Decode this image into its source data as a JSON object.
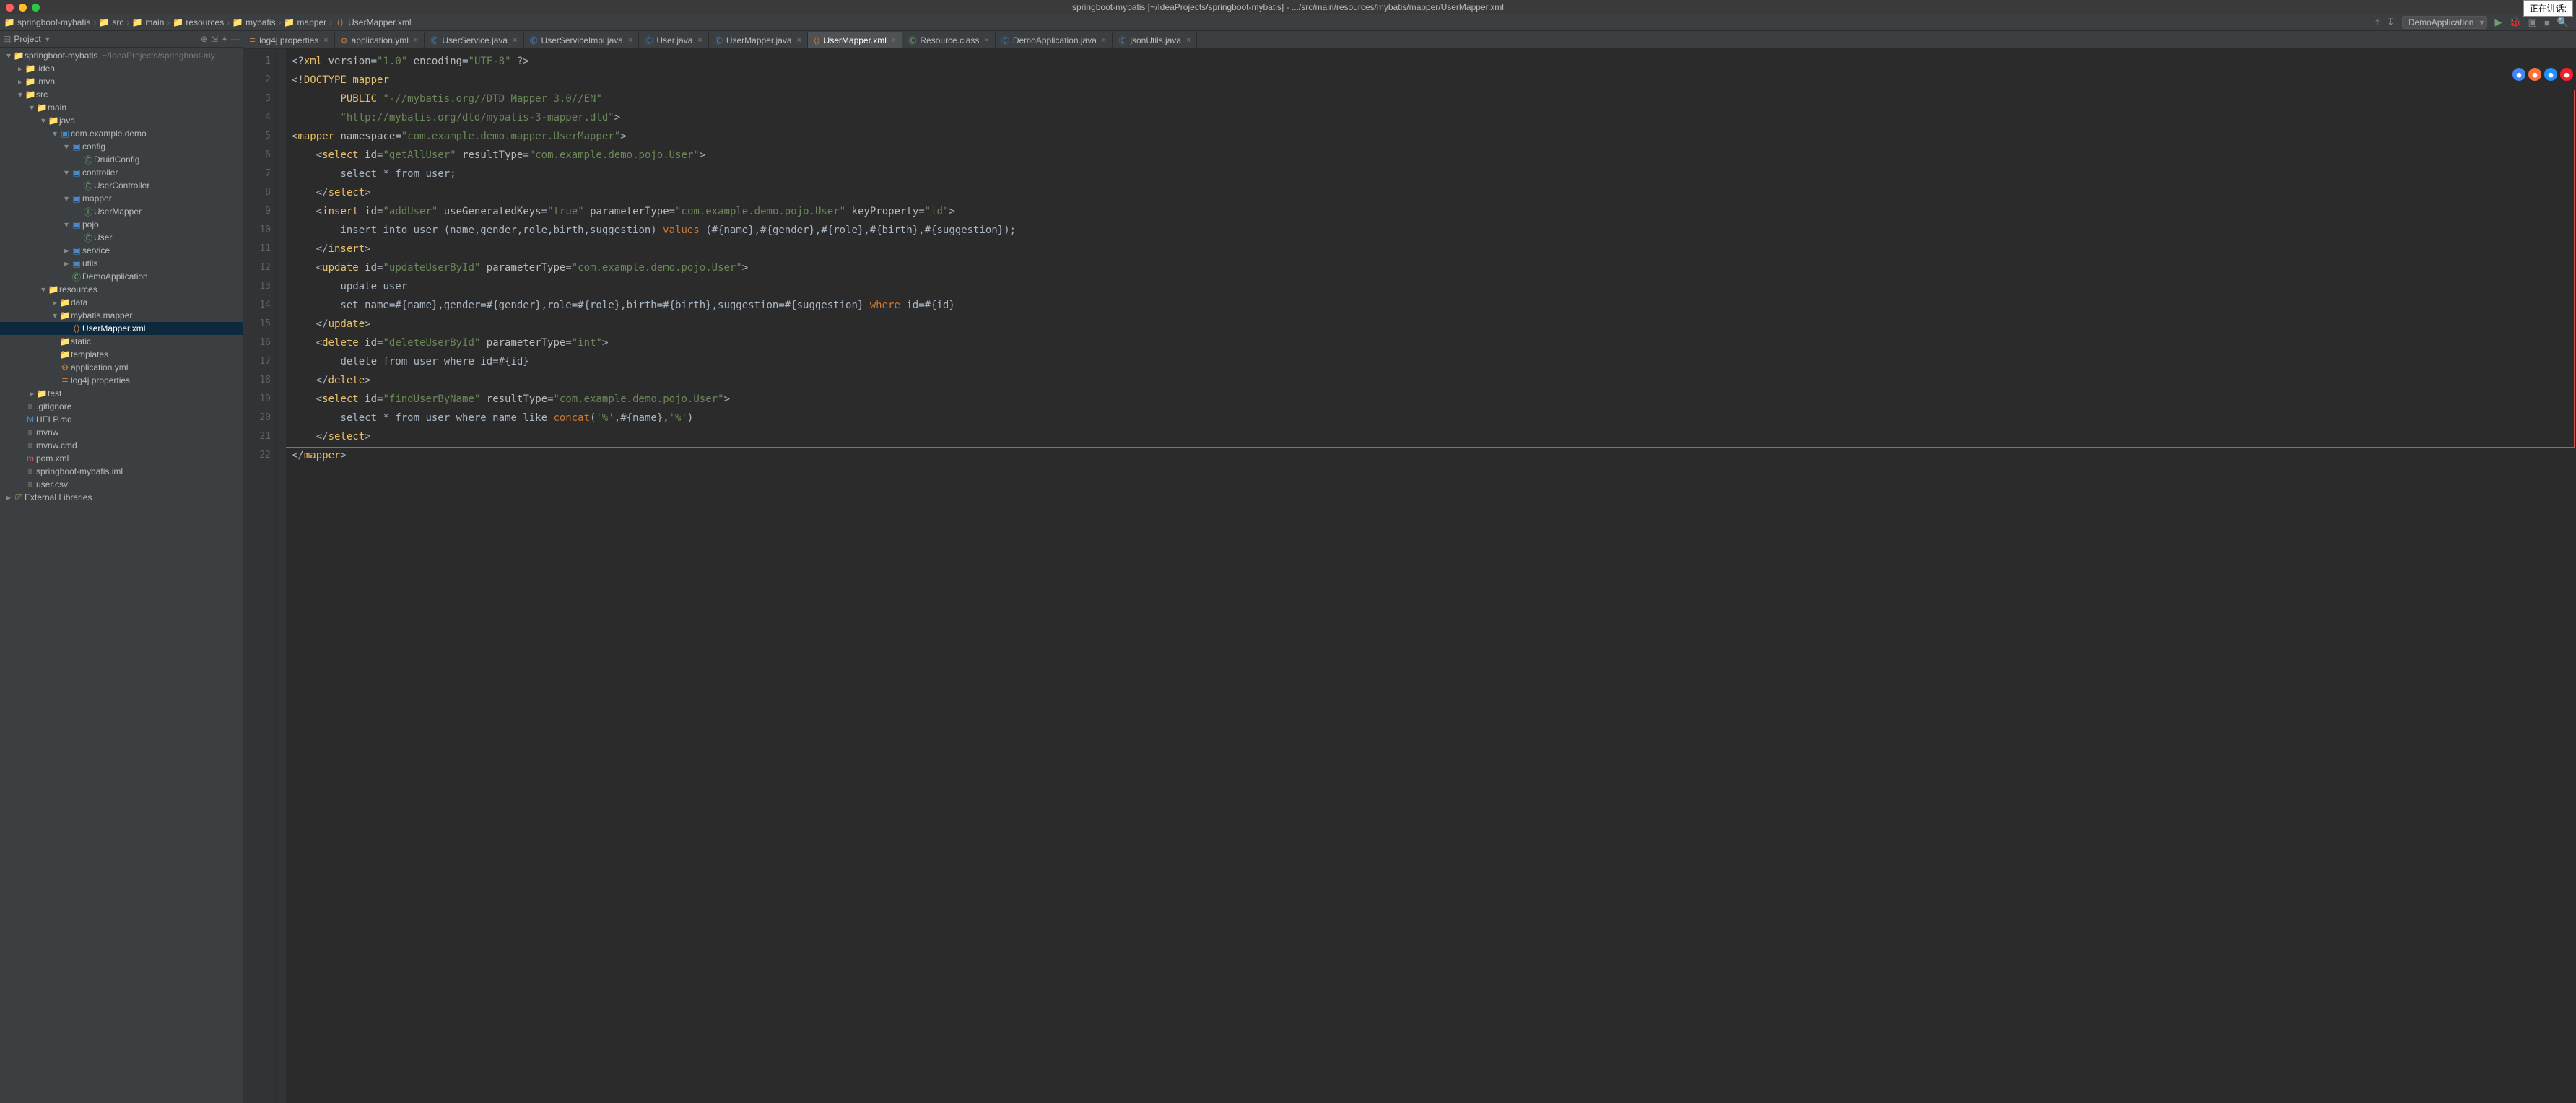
{
  "mac_title": "springboot-mybatis [~/IdeaProjects/springboot-mybatis] - .../src/main/resources/mybatis/mapper/UserMapper.xml",
  "speaking_label": "正在讲话:",
  "breadcrumbs": [
    {
      "icon": "folder",
      "label": "springboot-mybatis"
    },
    {
      "icon": "folder",
      "label": "src"
    },
    {
      "icon": "folder",
      "label": "main"
    },
    {
      "icon": "folder",
      "label": "resources"
    },
    {
      "icon": "folder",
      "label": "mybatis"
    },
    {
      "icon": "folder",
      "label": "mapper"
    },
    {
      "icon": "xml",
      "label": "UserMapper.xml"
    }
  ],
  "run_config": "DemoApplication",
  "project_pane_title": "Project",
  "tree": [
    {
      "d": 0,
      "tw": "▾",
      "ic": "folder",
      "lbl": "springboot-mybatis",
      "hint": "~/IdeaProjects/springboot-my…"
    },
    {
      "d": 1,
      "tw": "▸",
      "ic": "folder",
      "lbl": ".idea"
    },
    {
      "d": 1,
      "tw": "▸",
      "ic": "folder",
      "lbl": ".mvn"
    },
    {
      "d": 1,
      "tw": "▾",
      "ic": "folder",
      "lbl": "src"
    },
    {
      "d": 2,
      "tw": "▾",
      "ic": "folder",
      "lbl": "main"
    },
    {
      "d": 3,
      "tw": "▾",
      "ic": "folder-src",
      "lbl": "java"
    },
    {
      "d": 4,
      "tw": "▾",
      "ic": "package",
      "lbl": "com.example.demo"
    },
    {
      "d": 5,
      "tw": "▾",
      "ic": "package",
      "lbl": "config"
    },
    {
      "d": 6,
      "tw": "",
      "ic": "class",
      "lbl": "DruidConfig"
    },
    {
      "d": 5,
      "tw": "▾",
      "ic": "package",
      "lbl": "controller"
    },
    {
      "d": 6,
      "tw": "",
      "ic": "class",
      "lbl": "UserController"
    },
    {
      "d": 5,
      "tw": "▾",
      "ic": "package",
      "lbl": "mapper"
    },
    {
      "d": 6,
      "tw": "",
      "ic": "interface",
      "lbl": "UserMapper"
    },
    {
      "d": 5,
      "tw": "▾",
      "ic": "package",
      "lbl": "pojo"
    },
    {
      "d": 6,
      "tw": "",
      "ic": "class",
      "lbl": "User"
    },
    {
      "d": 5,
      "tw": "▸",
      "ic": "package",
      "lbl": "service"
    },
    {
      "d": 5,
      "tw": "▸",
      "ic": "package",
      "lbl": "utils"
    },
    {
      "d": 5,
      "tw": "",
      "ic": "class",
      "lbl": "DemoApplication"
    },
    {
      "d": 3,
      "tw": "▾",
      "ic": "folder-res",
      "lbl": "resources"
    },
    {
      "d": 4,
      "tw": "▸",
      "ic": "folder",
      "lbl": "data"
    },
    {
      "d": 4,
      "tw": "▾",
      "ic": "folder",
      "lbl": "mybatis.mapper"
    },
    {
      "d": 5,
      "tw": "",
      "ic": "xml",
      "lbl": "UserMapper.xml",
      "sel": true
    },
    {
      "d": 4,
      "tw": "",
      "ic": "folder",
      "lbl": "static"
    },
    {
      "d": 4,
      "tw": "",
      "ic": "folder",
      "lbl": "templates"
    },
    {
      "d": 4,
      "tw": "",
      "ic": "yml",
      "lbl": "application.yml"
    },
    {
      "d": 4,
      "tw": "",
      "ic": "prop",
      "lbl": "log4j.properties"
    },
    {
      "d": 2,
      "tw": "▸",
      "ic": "folder-src",
      "lbl": "test"
    },
    {
      "d": 1,
      "tw": "",
      "ic": "txt",
      "lbl": ".gitignore"
    },
    {
      "d": 1,
      "tw": "",
      "ic": "md",
      "lbl": "HELP.md"
    },
    {
      "d": 1,
      "tw": "",
      "ic": "txt",
      "lbl": "mvnw"
    },
    {
      "d": 1,
      "tw": "",
      "ic": "txt",
      "lbl": "mvnw.cmd"
    },
    {
      "d": 1,
      "tw": "",
      "ic": "m",
      "lbl": "pom.xml"
    },
    {
      "d": 1,
      "tw": "",
      "ic": "txt",
      "lbl": "springboot-mybatis.iml"
    },
    {
      "d": 1,
      "tw": "",
      "ic": "txt",
      "lbl": "user.csv"
    },
    {
      "d": 0,
      "tw": "▸",
      "ic": "lib",
      "lbl": "External Libraries"
    }
  ],
  "tabs": [
    {
      "ic": "prop",
      "label": "log4j.properties"
    },
    {
      "ic": "yml",
      "label": "application.yml"
    },
    {
      "ic": "java",
      "label": "UserService.java"
    },
    {
      "ic": "java",
      "label": "UserServiceImpl.java"
    },
    {
      "ic": "java",
      "label": "User.java"
    },
    {
      "ic": "java",
      "label": "UserMapper.java"
    },
    {
      "ic": "xml",
      "label": "UserMapper.xml",
      "active": true
    },
    {
      "ic": "class",
      "label": "Resource.class"
    },
    {
      "ic": "java",
      "label": "DemoApplication.java"
    },
    {
      "ic": "java",
      "label": "jsonUtils.java"
    }
  ],
  "line_count": 22,
  "code_lines": [
    {
      "html": "<span class='p'>&lt;?</span><span class='t'>xml</span> <span class='a'>version</span><span class='p'>=</span><span class='s'>\"1.0\"</span> <span class='a'>encoding</span><span class='p'>=</span><span class='s'>\"UTF-8\"</span> <span class='p'>?&gt;</span>"
    },
    {
      "html": "<span class='p'>&lt;!</span><span class='t'>DOCTYPE</span> <span class='t'>mapper</span>"
    },
    {
      "html": "        <span class='t'>PUBLIC</span> <span class='s'>\"-//mybatis.org//DTD Mapper 3.0//EN\"</span>"
    },
    {
      "html": "        <span class='s'>\"http://mybatis.org/dtd/mybatis-3-mapper.dtd\"</span><span class='p'>&gt;</span>"
    },
    {
      "html": "<span class='p'>&lt;</span><span class='t'>mapper</span> <span class='a'>namespace</span><span class='p'>=</span><span class='s'>\"com.example.demo.mapper.UserMapper\"</span><span class='p'>&gt;</span>"
    },
    {
      "html": "    <span class='p'>&lt;</span><span class='t'>select</span> <span class='a'>id</span><span class='p'>=</span><span class='s'>\"getAllUser\"</span> <span class='a'>resultType</span><span class='p'>=</span><span class='s'>\"com.example.demo.pojo.User\"</span><span class='p'>&gt;</span>"
    },
    {
      "html": "        <span class='txt'>select * from user;</span>"
    },
    {
      "html": "    <span class='p'>&lt;/</span><span class='t'>select</span><span class='p'>&gt;</span>"
    },
    {
      "html": "    <span class='p'>&lt;</span><span class='t'>insert</span> <span class='a'>id</span><span class='p'>=</span><span class='s'>\"addUser\"</span> <span class='a'>useGeneratedKeys</span><span class='p'>=</span><span class='s'>\"true\"</span> <span class='a'>parameterType</span><span class='p'>=</span><span class='s'>\"com.example.demo.pojo.User\"</span> <span class='a'>keyProperty</span><span class='p'>=</span><span class='s'>\"id\"</span><span class='p'>&gt;</span>"
    },
    {
      "html": "        <span class='txt'>insert into user (name,gender,role,birth,suggestion)</span> <span class='kw'>values</span> <span class='txt'>(#{name},#{gender},#{role},#{birth},#{suggestion});</span>"
    },
    {
      "html": "    <span class='p'>&lt;/</span><span class='t'>insert</span><span class='p'>&gt;</span>"
    },
    {
      "html": "    <span class='p'>&lt;</span><span class='t'>update</span> <span class='a'>id</span><span class='p'>=</span><span class='s'>\"updateUserById\"</span> <span class='a'>parameterType</span><span class='p'>=</span><span class='s'>\"com.example.demo.pojo.User\"</span><span class='p'>&gt;</span>"
    },
    {
      "html": "        <span class='txt'>update user</span>"
    },
    {
      "html": "        <span class='txt'>set name=#{name},gender=#{gender},role=#{role},birth=#{birth},suggestion=#{suggestion}</span> <span class='kw'>where</span> <span class='txt'>id=#{id}</span>"
    },
    {
      "html": "    <span class='p'>&lt;/</span><span class='t'>update</span><span class='p'>&gt;</span>"
    },
    {
      "html": "    <span class='p'>&lt;</span><span class='t'>delete</span> <span class='a'>id</span><span class='p'>=</span><span class='s'>\"deleteUserById\"</span> <span class='a'>parameterType</span><span class='p'>=</span><span class='s'>\"int\"</span><span class='p'>&gt;</span>"
    },
    {
      "html": "        <span class='txt'>delete from user where id=#{id}</span>"
    },
    {
      "html": "    <span class='p'>&lt;/</span><span class='t'>delete</span><span class='p'>&gt;</span>"
    },
    {
      "html": "    <span class='p'>&lt;</span><span class='t'>select</span> <span class='a'>id</span><span class='p'>=</span><span class='s'>\"findUserByName\"</span> <span class='a'>resultType</span><span class='p'>=</span><span class='s'>\"com.example.demo.pojo.User\"</span><span class='p'>&gt;</span>"
    },
    {
      "html": "        <span class='txt'>select * from user where name like</span> <span class='kw'>concat</span><span class='txt'>(</span><span class='s'>'%'</span><span class='txt'>,#{name},</span><span class='s'>'%'</span><span class='txt'>)</span>"
    },
    {
      "html": "    <span class='p'>&lt;/</span><span class='t'>select</span><span class='p'>&gt;</span>"
    },
    {
      "html": "<span class='p'>&lt;/</span><span class='t'>mapper</span><span class='p'>&gt;</span>"
    }
  ],
  "browsers": [
    "chrome",
    "firefox",
    "safari",
    "opera"
  ]
}
